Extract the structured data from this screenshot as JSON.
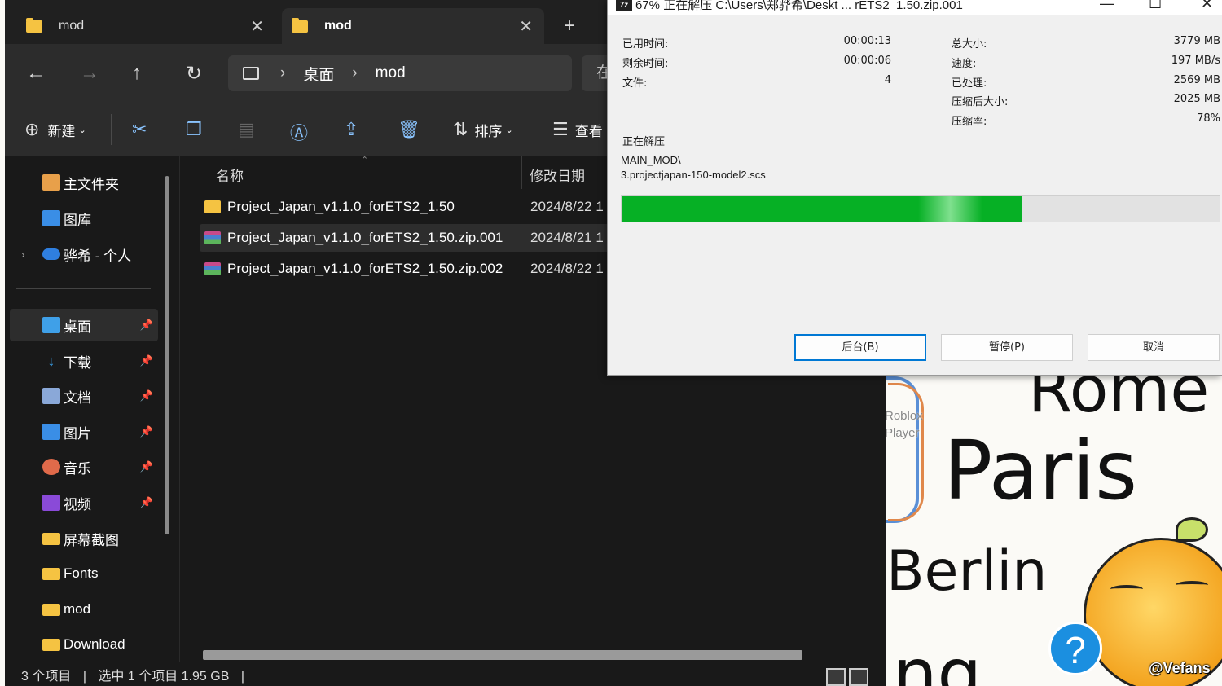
{
  "explorer": {
    "tabs": [
      {
        "label": "mod",
        "close": "✕"
      },
      {
        "label": "mod",
        "close": "✕"
      }
    ],
    "new_tab": "+",
    "nav": {
      "back": "←",
      "forward": "→",
      "up": "↑",
      "refresh": "↻"
    },
    "breadcrumb": [
      "桌面",
      "mod"
    ],
    "breadcrumb_sep": "›",
    "search_placeholder": "在",
    "toolbar": {
      "new_label": "新建",
      "sort_label": "排序",
      "view_label": "查看"
    },
    "sidebar": {
      "top_items": [
        {
          "label": "主文件夹",
          "icon": "home-icon"
        },
        {
          "label": "图库",
          "icon": "gallery-icon"
        },
        {
          "label": "骅希 - 个人",
          "icon": "onedrive-icon"
        }
      ],
      "pinned_items": [
        {
          "label": "桌面",
          "icon": "desktop-icon"
        },
        {
          "label": "下载",
          "icon": "download-icon"
        },
        {
          "label": "文档",
          "icon": "documents-icon"
        },
        {
          "label": "图片",
          "icon": "pictures-icon"
        },
        {
          "label": "音乐",
          "icon": "music-icon"
        },
        {
          "label": "视频",
          "icon": "videos-icon"
        }
      ],
      "folders": [
        "屏幕截图",
        "Fonts",
        "mod",
        "Download"
      ]
    },
    "columns": {
      "name": "名称",
      "modified": "修改日期"
    },
    "files": [
      {
        "name": "Project_Japan_v1.1.0_forETS2_1.50",
        "date": "2024/8/22 1",
        "type": "folder"
      },
      {
        "name": "Project_Japan_v1.1.0_forETS2_1.50.zip.001",
        "date": "2024/8/21 1",
        "type": "archive"
      },
      {
        "name": "Project_Japan_v1.1.0_forETS2_1.50.zip.002",
        "date": "2024/8/22 1",
        "type": "archive"
      }
    ],
    "status": {
      "count": "3 个项目",
      "selected": "选中 1 个项目  1.95 GB"
    }
  },
  "zip_dialog": {
    "title": "67% 正在解压 C:\\Users\\郑骅希\\Deskt ... rETS2_1.50.zip.001",
    "logo": "7z",
    "stats_left": [
      {
        "label": "已用时间:",
        "value": "00:00:13"
      },
      {
        "label": "剩余时间:",
        "value": "00:00:06"
      },
      {
        "label": "文件:",
        "value": "4"
      }
    ],
    "stats_right": [
      {
        "label": "总大小:",
        "value": "3779 MB"
      },
      {
        "label": "速度:",
        "value": "197 MB/s"
      },
      {
        "label": "已处理:",
        "value": "2569 MB"
      },
      {
        "label": "压缩后大小:",
        "value": "2025 MB"
      },
      {
        "label": "压缩率:",
        "value": "78%"
      }
    ],
    "operation": "正在解压",
    "current_path": "MAIN_MOD\\",
    "current_file": "3.projectjapan-150-model2.scs",
    "progress": 0.67,
    "buttons": {
      "background": "后台(B)",
      "pause": "暂停(P)",
      "cancel": "取消"
    }
  },
  "desktop": {
    "words": [
      "Rome",
      "Paris",
      "Berlin",
      "ng"
    ],
    "shortcut_label": "Roblox Player",
    "help": "?",
    "watermark": "@Vefans"
  },
  "colors": {
    "progress": "#06b025",
    "accent": "#0078d4",
    "folder": "#f5c342"
  }
}
